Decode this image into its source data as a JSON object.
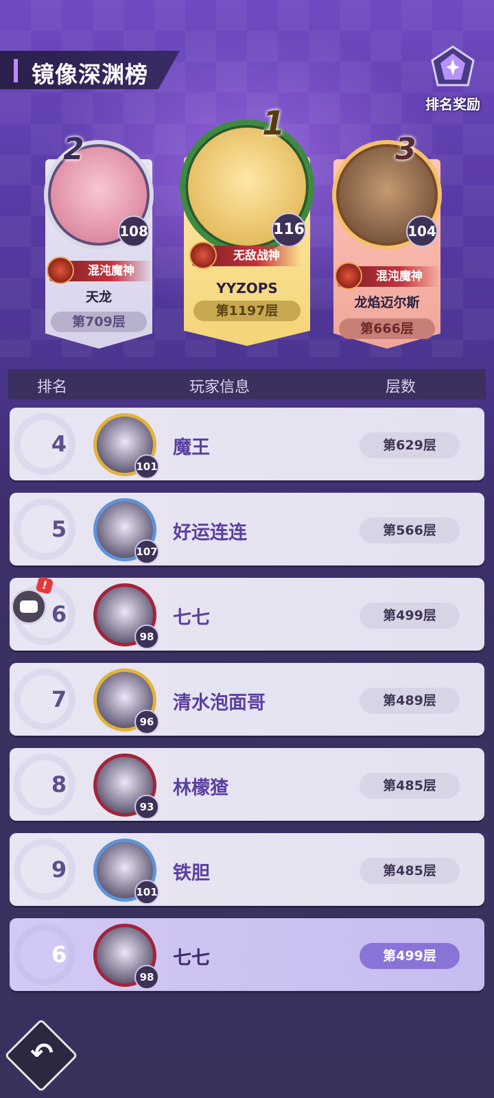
{
  "header": {
    "title": "镜像深渊榜",
    "reward_label": "排名奖励"
  },
  "podium": [
    {
      "rank": "2",
      "level": "108",
      "title": "混沌魔神",
      "name": "天龙",
      "floor": "第709层"
    },
    {
      "rank": "1",
      "level": "116",
      "title": "无敌战神",
      "name": "YYZOPS",
      "floor": "第1197层"
    },
    {
      "rank": "3",
      "level": "104",
      "title": "混沌魔神",
      "name": "龙焰迈尔斯",
      "floor": "第666层"
    }
  ],
  "table": {
    "col_rank": "排名",
    "col_info": "玩家信息",
    "col_floor": "层数"
  },
  "rows": [
    {
      "rank": "4",
      "level": "101",
      "name": "魔王",
      "floor": "第629层"
    },
    {
      "rank": "5",
      "level": "107",
      "name": "好运连连",
      "floor": "第566层"
    },
    {
      "rank": "6",
      "level": "98",
      "name": "七七",
      "floor": "第499层"
    },
    {
      "rank": "7",
      "level": "96",
      "name": "清水泡面哥",
      "floor": "第489层"
    },
    {
      "rank": "8",
      "level": "93",
      "name": "林檬猹",
      "floor": "第485层"
    },
    {
      "rank": "9",
      "level": "101",
      "name": "铁胆",
      "floor": "第485层"
    }
  ],
  "me": {
    "rank": "6",
    "level": "98",
    "name": "七七",
    "floor": "第499层"
  },
  "chat": {
    "badge": "!"
  },
  "icons": {
    "reward": "trophy-gem-icon",
    "back": "back-arrow-icon",
    "chat": "chat-bubble-icon"
  }
}
